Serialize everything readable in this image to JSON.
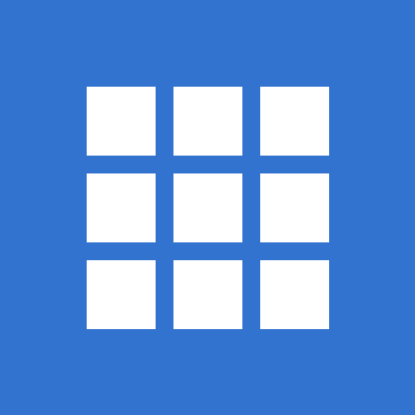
{
  "icon": {
    "name": "app-grid-icon",
    "background_color": "#3273d0",
    "foreground_color": "#ffffff",
    "rows": 3,
    "columns": 3
  }
}
